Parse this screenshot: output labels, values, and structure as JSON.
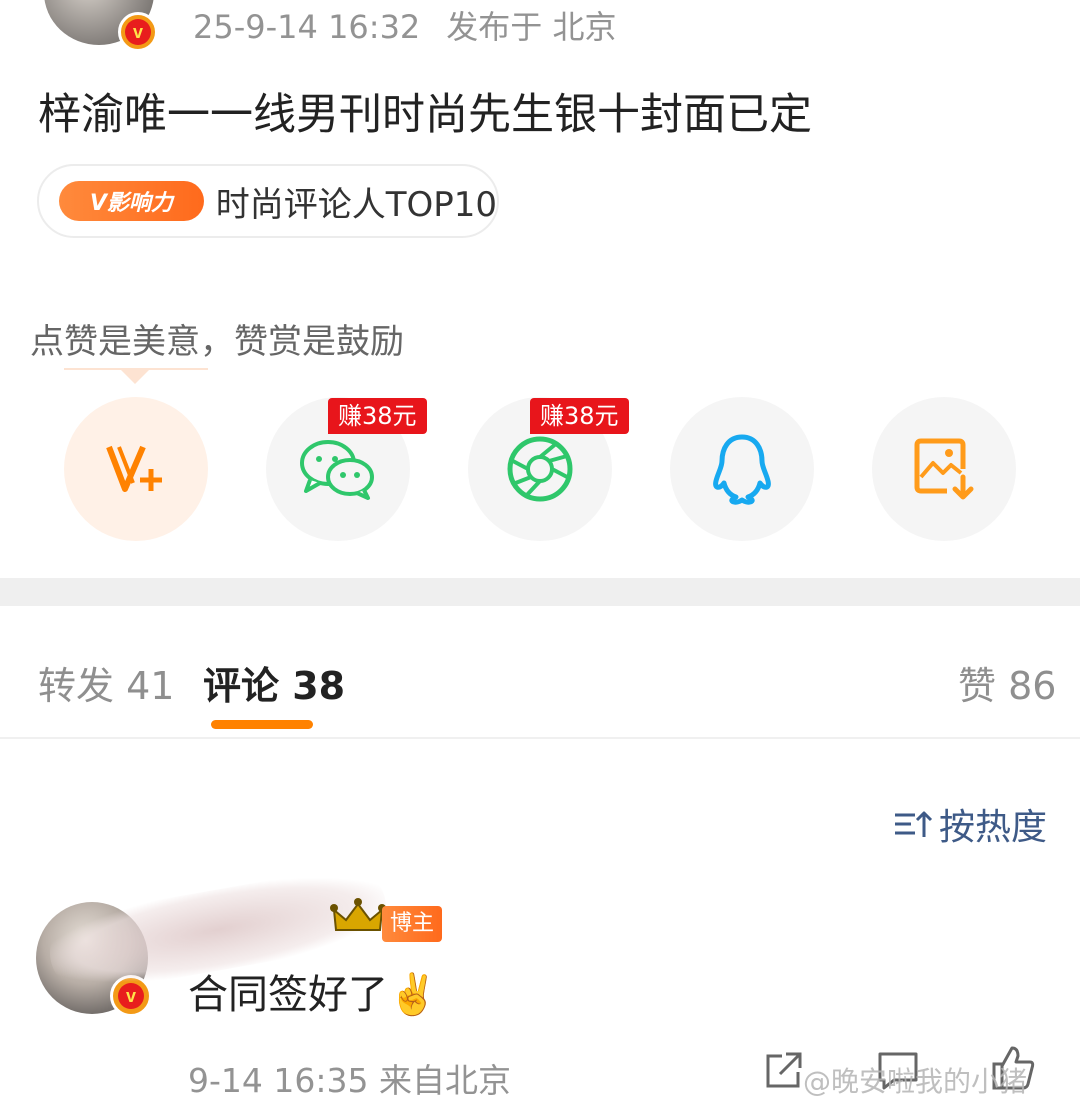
{
  "post": {
    "time": "25-9-14 16:32",
    "location": "发布于 北京",
    "title": "梓渝唯一一线男刊时尚先生银十封面已定",
    "tag": {
      "badge": "V影响力",
      "text": "时尚评论人TOP10"
    }
  },
  "reward_hint": "点赞是美意，赞赏是鼓励",
  "share": {
    "items": [
      {
        "icon": "vplus-reward-icon"
      },
      {
        "icon": "wechat-icon",
        "earn": "赚38元"
      },
      {
        "icon": "moments-icon",
        "earn": "赚38元"
      },
      {
        "icon": "qq-icon"
      },
      {
        "icon": "save-image-icon"
      }
    ]
  },
  "tabs": {
    "repost": "转发 41",
    "comments": "评论 38",
    "likes": "赞 86"
  },
  "sort_label": "按热度",
  "comment": {
    "badge": "博主",
    "text": "合同签好了✌️",
    "meta": "9-14 16:35  来自北京"
  },
  "watermark": "@晚安啦我的小猪",
  "colors": {
    "accent": "#ff8200",
    "link": "#3e5a87",
    "earn_badge": "#e8151b"
  }
}
